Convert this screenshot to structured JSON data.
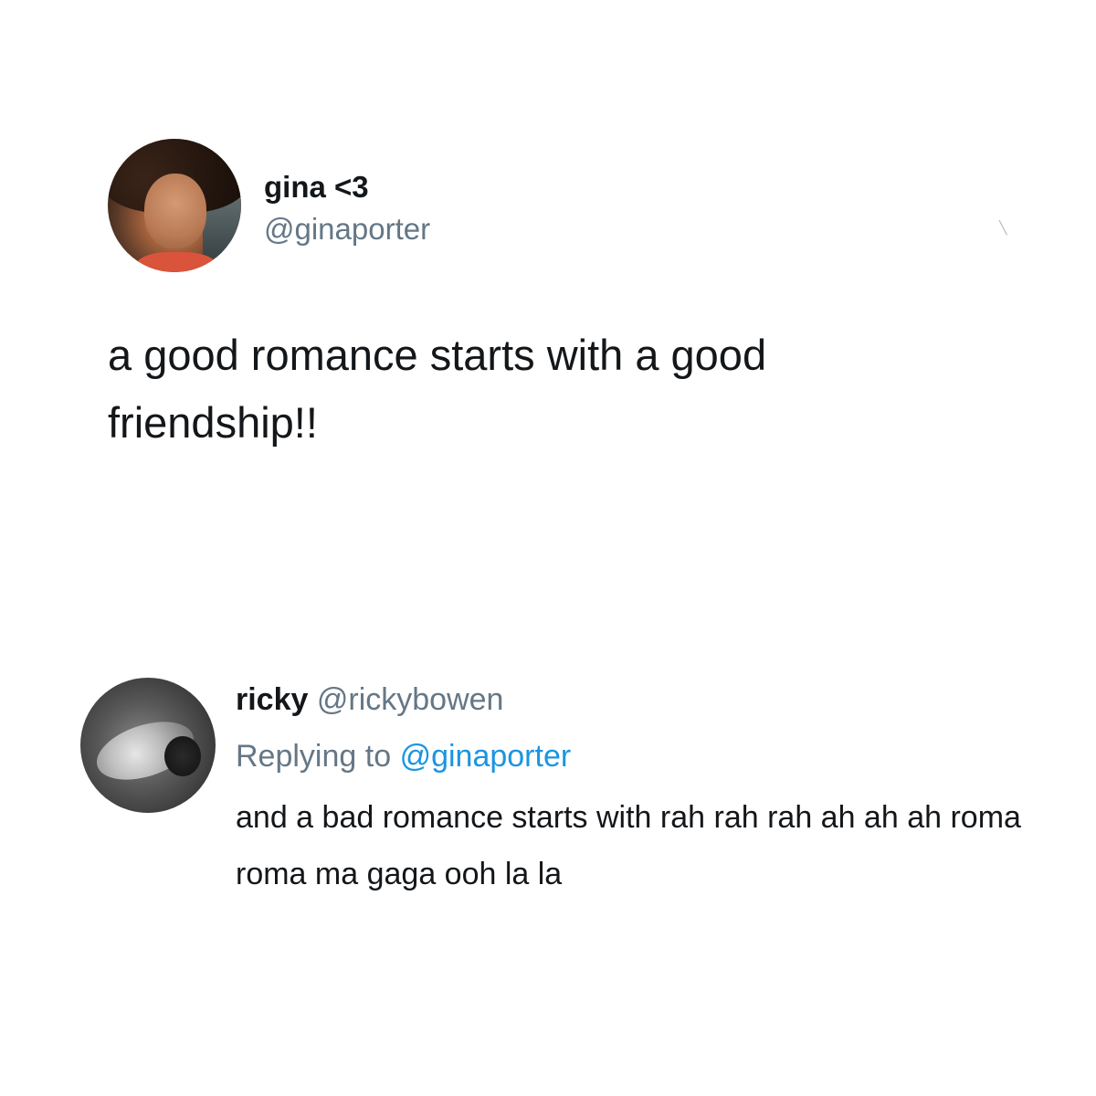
{
  "tweet": {
    "author": {
      "display_name": "gina <3",
      "handle": "@ginaporter",
      "avatar_icon": "user-avatar-photo"
    },
    "text": "a good romance starts with a good friendship!!",
    "menu_icon": "chevron-down-icon"
  },
  "reply": {
    "author": {
      "display_name": "ricky",
      "handle": "@rickybowen",
      "avatar_icon": "user-avatar-photo"
    },
    "replying_to_prefix": "Replying to",
    "replying_to_handle": "@ginaporter",
    "text": "and a bad romance starts with rah rah rah ah ah ah roma roma ma gaga ooh la la"
  },
  "colors": {
    "text_primary": "#14171a",
    "text_secondary": "#657786",
    "link": "#1b95e0",
    "background": "#ffffff"
  }
}
